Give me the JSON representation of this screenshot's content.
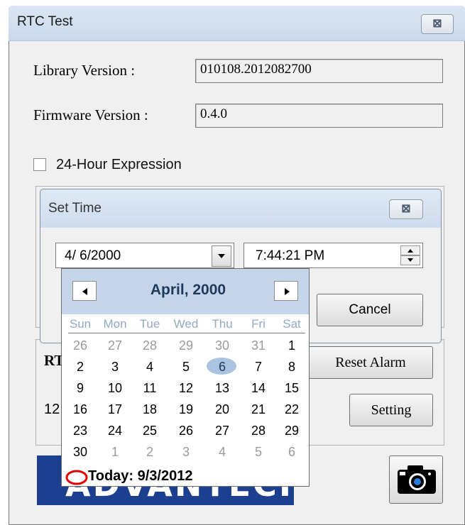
{
  "window": {
    "title": "RTC Test",
    "close_glyph": "⊠"
  },
  "info": {
    "library_label": "Library Version :",
    "library_value": "010108.2012082700",
    "firmware_label": "Firmware Version :",
    "firmware_value": "0.4.0"
  },
  "option": {
    "checkbox_label": "24-Hour Expression",
    "checked": false
  },
  "background": {
    "rt_partial": "RT",
    "twelve_partial": "12",
    "reset_alarm_label": "Reset Alarm",
    "setting_label": "Setting",
    "logo_text": "ADVANTECH",
    "camera_icon": "camera-icon"
  },
  "set_time": {
    "title": "Set Time",
    "close_glyph": "⊠",
    "date_value": "4/ 6/2000",
    "time_value": "7:44:21 PM",
    "cancel_label": "Cancel"
  },
  "calendar": {
    "month_label": "April, 2000",
    "prev_glyph": "◀",
    "next_glyph": "▶",
    "weekdays": [
      "Sun",
      "Mon",
      "Tue",
      "Wed",
      "Thu",
      "Fri",
      "Sat"
    ],
    "weeks": [
      [
        "26",
        "27",
        "28",
        "29",
        "30",
        "31",
        "1"
      ],
      [
        "2",
        "3",
        "4",
        "5",
        "6",
        "7",
        "8"
      ],
      [
        "9",
        "10",
        "11",
        "12",
        "13",
        "14",
        "15"
      ],
      [
        "16",
        "17",
        "18",
        "19",
        "20",
        "21",
        "22"
      ],
      [
        "23",
        "24",
        "25",
        "26",
        "27",
        "28",
        "29"
      ],
      [
        "30",
        "1",
        "2",
        "3",
        "4",
        "5",
        "6"
      ]
    ],
    "selected_day": "6",
    "today_label": "Today: 9/3/2012",
    "accent_color": "#c5d6ea",
    "today_marker_color": "#e00000"
  }
}
